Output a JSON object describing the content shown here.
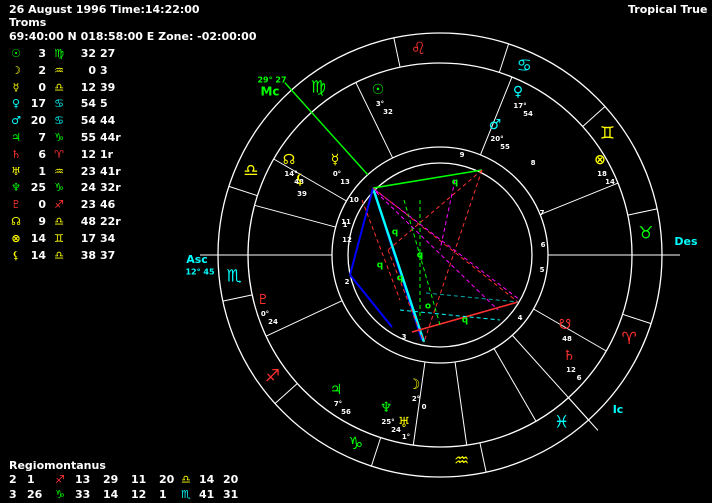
{
  "header": {
    "datetime": "26 August 1996 Time:14:22:00",
    "place": "Troms",
    "coords": "69:40:00 N 018:58:00 E Zone: -02:00:00",
    "mode": "Tropical True"
  },
  "planets": [
    {
      "name": "sun",
      "glyph": "☉",
      "color": "#00ff00",
      "deg": "3",
      "sign": "♍",
      "sign_color": "#00ff00",
      "min": "32",
      "sec": "27"
    },
    {
      "name": "moon",
      "glyph": "☽",
      "color": "#ffff00",
      "deg": "2",
      "sign": "♒",
      "sign_color": "#ffff00",
      "min": "0",
      "sec": "3"
    },
    {
      "name": "mercury",
      "glyph": "☿",
      "color": "#ffff00",
      "deg": "0",
      "sign": "♎",
      "sign_color": "#ffff00",
      "min": "12",
      "sec": "39"
    },
    {
      "name": "venus",
      "glyph": "♀",
      "color": "#00ffff",
      "deg": "17",
      "sign": "♋",
      "sign_color": "#00ffff",
      "min": "54",
      "sec": "5"
    },
    {
      "name": "mars",
      "glyph": "♂",
      "color": "#00ffff",
      "deg": "20",
      "sign": "♋",
      "sign_color": "#00ffff",
      "min": "54",
      "sec": "44"
    },
    {
      "name": "jupiter",
      "glyph": "♃",
      "color": "#00ff00",
      "deg": "7",
      "sign": "♑",
      "sign_color": "#00ff00",
      "min": "55",
      "sec": "44r"
    },
    {
      "name": "saturn",
      "glyph": "♄",
      "color": "#ff3030",
      "deg": "6",
      "sign": "♈",
      "sign_color": "#ff3030",
      "min": "12",
      "sec": "1r"
    },
    {
      "name": "uranus",
      "glyph": "♅",
      "color": "#ffff00",
      "deg": "1",
      "sign": "♒",
      "sign_color": "#ffff00",
      "min": "23",
      "sec": "41r"
    },
    {
      "name": "neptune",
      "glyph": "♆",
      "color": "#00ff00",
      "deg": "25",
      "sign": "♑",
      "sign_color": "#00ff00",
      "min": "24",
      "sec": "32r"
    },
    {
      "name": "pluto",
      "glyph": "♇",
      "color": "#ff3030",
      "deg": "0",
      "sign": "♐",
      "sign_color": "#ff3030",
      "min": "23",
      "sec": "46"
    },
    {
      "name": "node",
      "glyph": "☊",
      "color": "#ffff00",
      "deg": "9",
      "sign": "♎",
      "sign_color": "#ffff00",
      "min": "48",
      "sec": "22r"
    },
    {
      "name": "fortune",
      "glyph": "⊗",
      "color": "#ffff00",
      "deg": "14",
      "sign": "♊",
      "sign_color": "#ffff00",
      "min": "17",
      "sec": "34"
    },
    {
      "name": "lilith",
      "glyph": "⚸",
      "color": "#ffff00",
      "deg": "14",
      "sign": "♎",
      "sign_color": "#ffff00",
      "min": "38",
      "sec": "37"
    }
  ],
  "houses": {
    "title": "Regiomontanus",
    "row1": [
      {
        "n": "2",
        "deg": "1",
        "sign": "♐",
        "color": "#ff3030",
        "min": "13"
      },
      {
        "n": "",
        "deg": "29",
        "sign": "",
        "color": "#fff",
        "min": "11"
      },
      {
        "n": "",
        "deg": "20",
        "sign": "♎",
        "color": "#ffff00",
        "min": "14"
      },
      {
        "n": "",
        "deg": "20",
        "sign": "",
        "color": "#fff",
        "min": ""
      }
    ],
    "row1_text": [
      "2",
      "1",
      "♐",
      "13",
      "29",
      "11",
      "20",
      "♎",
      "14",
      "20"
    ],
    "row2_text": [
      "3",
      "26",
      "♑",
      "33",
      "14",
      "12",
      "1",
      "♏",
      "41",
      "31"
    ]
  },
  "wheel": {
    "zodiac_glyphs": [
      {
        "glyph": "♌",
        "color": "#ff3030"
      },
      {
        "glyph": "♋",
        "color": "#00ffff"
      },
      {
        "glyph": "♊",
        "color": "#ffff00"
      },
      {
        "glyph": "♉",
        "color": "#00ff00"
      },
      {
        "glyph": "♈",
        "color": "#ff3030"
      },
      {
        "glyph": "♓",
        "color": "#00ffff"
      },
      {
        "glyph": "♒",
        "color": "#ffff00"
      },
      {
        "glyph": "♑",
        "color": "#00ff00"
      },
      {
        "glyph": "♐",
        "color": "#ff3030"
      },
      {
        "glyph": "♏",
        "color": "#00ffff"
      },
      {
        "glyph": "♎",
        "color": "#ffff00"
      },
      {
        "glyph": "♍",
        "color": "#00ff00"
      }
    ],
    "mc_label": "Mc",
    "mc_deg": "29° 27",
    "asc_label": "Asc",
    "asc_deg": "12° 45",
    "des_label": "Des",
    "ic_label": "Ic",
    "house_numbers": [
      "1",
      "2",
      "3",
      "4",
      "5",
      "6",
      "7",
      "8",
      "9",
      "10",
      "11",
      "12"
    ],
    "placed": [
      {
        "glyph": "☉",
        "color": "#00ff00",
        "deg": "3°",
        "min": "32"
      },
      {
        "glyph": "♀",
        "color": "#00ffff",
        "deg": "17°",
        "min": "54"
      },
      {
        "glyph": "♂",
        "color": "#00ffff",
        "deg": "20°",
        "min": "55"
      },
      {
        "glyph": "⊗",
        "color": "#ffff00",
        "deg": "18",
        "min": "14"
      },
      {
        "glyph": "☊",
        "color": "#ffff00",
        "deg": "14°",
        "min": "48"
      },
      {
        "glyph": "⚸",
        "color": "#ffff00",
        "deg": "39",
        "min": ""
      },
      {
        "glyph": "☿",
        "color": "#ffff00",
        "deg": "0°",
        "min": "13"
      },
      {
        "glyph": "♇",
        "color": "#ff3030",
        "deg": "0°",
        "min": "24"
      },
      {
        "glyph": "♃",
        "color": "#00ff00",
        "deg": "7°",
        "min": "56"
      },
      {
        "glyph": "♆",
        "color": "#00ff00",
        "deg": "25°",
        "min": "24"
      },
      {
        "glyph": "♅",
        "color": "#ffff00",
        "deg": "1°",
        "min": ""
      },
      {
        "glyph": "☽",
        "color": "#ffff00",
        "deg": "2°",
        "min": "0"
      },
      {
        "glyph": "♄",
        "color": "#ff3030",
        "deg": "12",
        "min": "6"
      },
      {
        "glyph": "☋",
        "color": "#ff3030",
        "deg": "48",
        "min": ""
      }
    ],
    "aspect_marks": [
      "q",
      "q",
      "o",
      "q",
      "q",
      "q",
      "q"
    ]
  }
}
